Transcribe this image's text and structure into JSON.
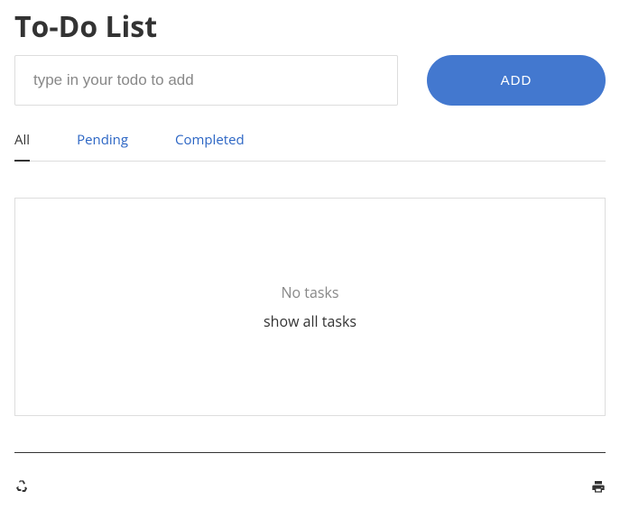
{
  "title": "To-Do List",
  "input": {
    "placeholder": "type in your todo to add",
    "value": ""
  },
  "addButton": "ADD",
  "tabs": {
    "all": "All",
    "pending": "Pending",
    "completed": "Completed",
    "active": "all"
  },
  "panel": {
    "emptyMessage": "No tasks",
    "showAllLink": "show all tasks"
  }
}
